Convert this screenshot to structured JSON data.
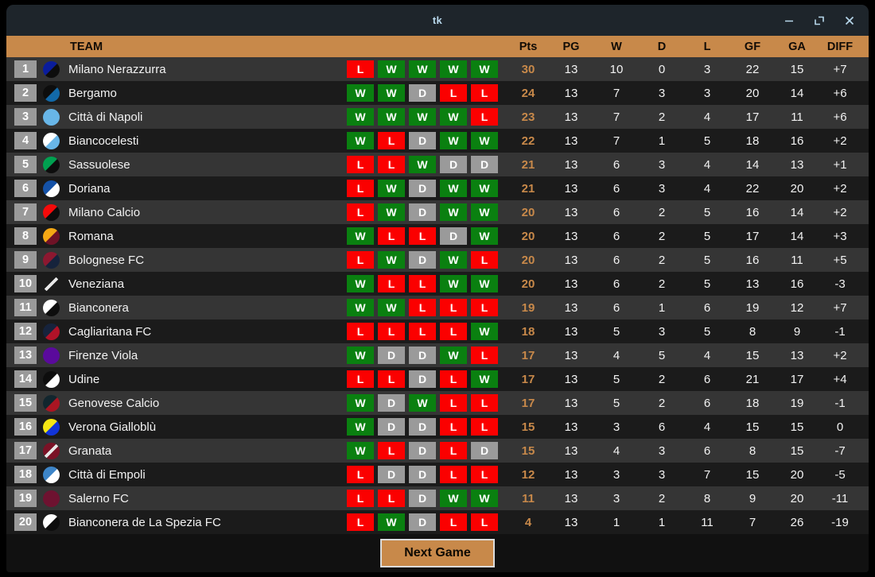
{
  "window": {
    "title": "tk",
    "controls": [
      {
        "name": "minimize-button",
        "glyph": "−"
      },
      {
        "name": "maximize-button",
        "glyph": "⤡"
      },
      {
        "name": "close-button",
        "glyph": "✕"
      }
    ]
  },
  "colors": {
    "accent": "#c8894a",
    "win_green": "#0a8010",
    "loss_red": "#fb0000",
    "draw_gray": "#9a9a9a",
    "titlebar": "#1e252b",
    "row_odd": "#353535",
    "row_even": "#1b1b1b",
    "title_text": "#b8d8ec"
  },
  "table": {
    "headers": {
      "team": "TEAM",
      "form": "",
      "pts": "Pts",
      "pg": "PG",
      "w": "W",
      "d": "D",
      "l": "L",
      "gf": "GF",
      "ga": "GA",
      "diff": "DIFF"
    },
    "rows": [
      {
        "rank": "1",
        "team": "Milano Nerazzurra",
        "badge": [
          "#0a1d9c",
          "#0d0d0d"
        ],
        "form": [
          "L",
          "W",
          "W",
          "W",
          "W"
        ],
        "pts": "30",
        "pg": "13",
        "w": "10",
        "d": "0",
        "l": "3",
        "gf": "22",
        "ga": "15",
        "diff": "+7"
      },
      {
        "rank": "2",
        "team": "Bergamo",
        "badge": [
          "#0d0d0d",
          "#1269a8"
        ],
        "form": [
          "W",
          "W",
          "D",
          "L",
          "L"
        ],
        "pts": "24",
        "pg": "13",
        "w": "7",
        "d": "3",
        "l": "3",
        "gf": "20",
        "ga": "14",
        "diff": "+6"
      },
      {
        "rank": "3",
        "team": "Città di Napoli",
        "badge": [
          "#68b6e8",
          "#68b6e8"
        ],
        "form": [
          "W",
          "W",
          "W",
          "W",
          "L"
        ],
        "pts": "23",
        "pg": "13",
        "w": "7",
        "d": "2",
        "l": "4",
        "gf": "17",
        "ga": "11",
        "diff": "+6"
      },
      {
        "rank": "4",
        "team": "Biancocelesti",
        "badge": [
          "#ffffff",
          "#68b6e8"
        ],
        "form": [
          "W",
          "L",
          "D",
          "W",
          "W"
        ],
        "pts": "22",
        "pg": "13",
        "w": "7",
        "d": "1",
        "l": "5",
        "gf": "18",
        "ga": "16",
        "diff": "+2"
      },
      {
        "rank": "5",
        "team": "Sassuolese",
        "badge": [
          "#00a050",
          "#0d0d0d"
        ],
        "form": [
          "L",
          "L",
          "W",
          "D",
          "D"
        ],
        "pts": "21",
        "pg": "13",
        "w": "6",
        "d": "3",
        "l": "4",
        "gf": "14",
        "ga": "13",
        "diff": "+1"
      },
      {
        "rank": "6",
        "team": "Doriana",
        "badge": [
          "#1552a8",
          "#ffffff"
        ],
        "form": [
          "L",
          "W",
          "D",
          "W",
          "W"
        ],
        "pts": "21",
        "pg": "13",
        "w": "6",
        "d": "3",
        "l": "4",
        "gf": "22",
        "ga": "20",
        "diff": "+2"
      },
      {
        "rank": "7",
        "team": "Milano Calcio",
        "badge": [
          "#f50a0a",
          "#0d0d0d"
        ],
        "form": [
          "L",
          "W",
          "D",
          "W",
          "W"
        ],
        "pts": "20",
        "pg": "13",
        "w": "6",
        "d": "2",
        "l": "5",
        "gf": "16",
        "ga": "14",
        "diff": "+2"
      },
      {
        "rank": "8",
        "team": "Romana",
        "badge": [
          "#f5a814",
          "#6e1226"
        ],
        "form": [
          "W",
          "L",
          "L",
          "D",
          "W"
        ],
        "pts": "20",
        "pg": "13",
        "w": "6",
        "d": "2",
        "l": "5",
        "gf": "17",
        "ga": "14",
        "diff": "+3"
      },
      {
        "rank": "9",
        "team": "Bolognese FC",
        "badge": [
          "#8c1830",
          "#16233c"
        ],
        "form": [
          "L",
          "W",
          "D",
          "W",
          "L"
        ],
        "pts": "20",
        "pg": "13",
        "w": "6",
        "d": "2",
        "l": "5",
        "gf": "16",
        "ga": "11",
        "diff": "+5"
      },
      {
        "rank": "10",
        "team": "Veneziana",
        "badge": [
          "#1b1b1b",
          "#1b1b1b"
        ],
        "form": [
          "W",
          "L",
          "L",
          "W",
          "W"
        ],
        "pts": "20",
        "pg": "13",
        "w": "6",
        "d": "2",
        "l": "5",
        "gf": "13",
        "ga": "16",
        "diff": "-3"
      },
      {
        "rank": "11",
        "team": "Bianconera",
        "badge": [
          "#ffffff",
          "#0d0d0d"
        ],
        "form": [
          "W",
          "W",
          "L",
          "L",
          "L"
        ],
        "pts": "19",
        "pg": "13",
        "w": "6",
        "d": "1",
        "l": "6",
        "gf": "19",
        "ga": "12",
        "diff": "+7"
      },
      {
        "rank": "12",
        "team": "Cagliaritana FC",
        "badge": [
          "#16233c",
          "#b01228"
        ],
        "form": [
          "L",
          "L",
          "L",
          "L",
          "W"
        ],
        "pts": "18",
        "pg": "13",
        "w": "5",
        "d": "3",
        "l": "5",
        "gf": "8",
        "ga": "9",
        "diff": "-1"
      },
      {
        "rank": "13",
        "team": "Firenze Viola",
        "badge": [
          "#5a0a9c",
          "#5a0a9c"
        ],
        "form": [
          "W",
          "D",
          "D",
          "W",
          "L"
        ],
        "pts": "17",
        "pg": "13",
        "w": "4",
        "d": "5",
        "l": "4",
        "gf": "15",
        "ga": "13",
        "diff": "+2"
      },
      {
        "rank": "14",
        "team": "Udine",
        "badge": [
          "#0d0d0d",
          "#ffffff"
        ],
        "form": [
          "L",
          "L",
          "D",
          "L",
          "W"
        ],
        "pts": "17",
        "pg": "13",
        "w": "5",
        "d": "2",
        "l": "6",
        "gf": "21",
        "ga": "17",
        "diff": "+4"
      },
      {
        "rank": "15",
        "team": "Genovese Calcio",
        "badge": [
          "#12262e",
          "#aa1522"
        ],
        "form": [
          "W",
          "D",
          "W",
          "L",
          "L"
        ],
        "pts": "17",
        "pg": "13",
        "w": "5",
        "d": "2",
        "l": "6",
        "gf": "18",
        "ga": "19",
        "diff": "-1"
      },
      {
        "rank": "16",
        "team": "Verona Gialloblù",
        "badge": [
          "#f5e614",
          "#1234d8"
        ],
        "form": [
          "W",
          "D",
          "D",
          "L",
          "L"
        ],
        "pts": "15",
        "pg": "13",
        "w": "3",
        "d": "6",
        "l": "4",
        "gf": "15",
        "ga": "15",
        "diff": "0"
      },
      {
        "rank": "17",
        "team": "Granata",
        "badge": [
          "#7a1226",
          "#7a1226"
        ],
        "form": [
          "W",
          "L",
          "D",
          "L",
          "D"
        ],
        "pts": "15",
        "pg": "13",
        "w": "4",
        "d": "3",
        "l": "6",
        "gf": "8",
        "ga": "15",
        "diff": "-7"
      },
      {
        "rank": "18",
        "team": "Città di Empoli",
        "badge": [
          "#3d85c8",
          "#ffffff"
        ],
        "form": [
          "L",
          "D",
          "D",
          "L",
          "L"
        ],
        "pts": "12",
        "pg": "13",
        "w": "3",
        "d": "3",
        "l": "7",
        "gf": "15",
        "ga": "20",
        "diff": "-5"
      },
      {
        "rank": "19",
        "team": "Salerno FC",
        "badge": [
          "#6e1230",
          "#6e1230"
        ],
        "form": [
          "L",
          "L",
          "D",
          "W",
          "W"
        ],
        "pts": "11",
        "pg": "13",
        "w": "3",
        "d": "2",
        "l": "8",
        "gf": "9",
        "ga": "20",
        "diff": "-11"
      },
      {
        "rank": "20",
        "team": "Bianconera de La Spezia FC",
        "badge": [
          "#ffffff",
          "#0d0d0d"
        ],
        "form": [
          "L",
          "W",
          "D",
          "L",
          "L"
        ],
        "pts": "4",
        "pg": "13",
        "w": "1",
        "d": "1",
        "l": "11",
        "gf": "7",
        "ga": "26",
        "diff": "-19"
      }
    ]
  },
  "footer": {
    "next_game_label": "Next Game"
  }
}
